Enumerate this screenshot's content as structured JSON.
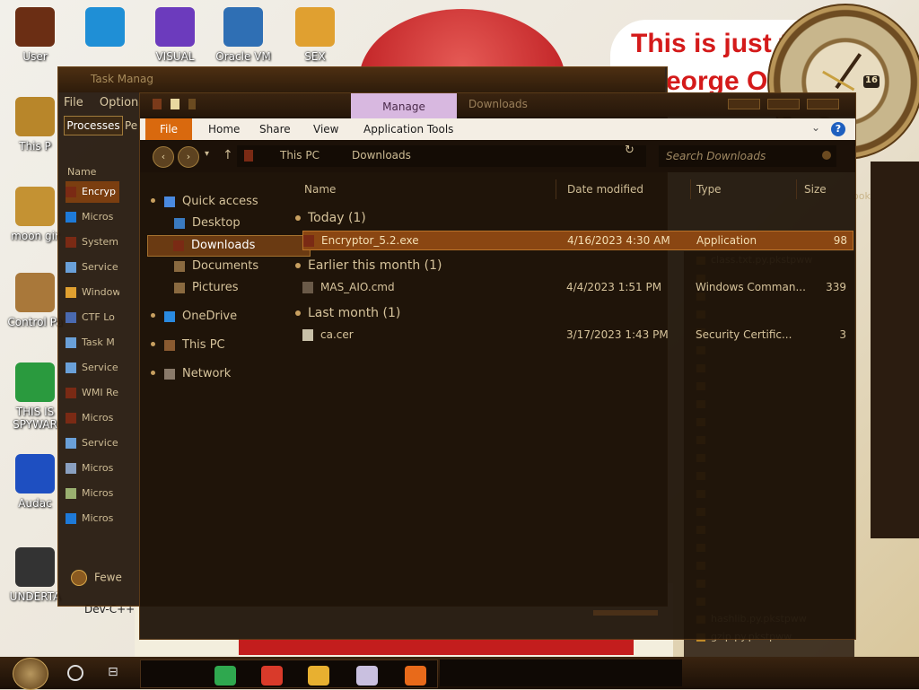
{
  "desktop": {
    "notice_line1": "This is just th",
    "notice_line2": "eorge Or",
    "clock_number": "16",
    "icons": [
      {
        "label": "User",
        "color": "#6b2e14"
      },
      {
        "label": "This P",
        "color": "#b8862a"
      },
      {
        "label": "moon gir",
        "color": "#c49233"
      },
      {
        "label": "Control Pa",
        "color": "#a9783a"
      },
      {
        "label": "THIS IS SPYWAR",
        "color": "#2a9a3e"
      },
      {
        "label": "Audac",
        "color": "#1e4fc1"
      },
      {
        "label": "UNDERTA",
        "color": "#333333"
      }
    ],
    "top_icons": [
      {
        "label": "",
        "color": "#1f8fd6"
      },
      {
        "label": "VISUAL",
        "color": "#6c3bbd"
      },
      {
        "label": "Oracle VM",
        "color": "#2f6fb4"
      },
      {
        "label": "SEX",
        "color": "#e0a030"
      }
    ],
    "bookmark": "ookmark   To",
    "right_list": [
      "class.txt.py.pkstpww",
      "",
      "",
      "",
      "",
      "",
      "",
      "",
      "",
      "",
      "",
      "",
      "",
      "",
      "",
      "",
      "",
      "",
      "",
      "",
      "hashlib.py.pkstpww",
      "gzip.py.pkstpww"
    ],
    "devcpp": "Dev-C++"
  },
  "task_manager": {
    "title": "Task Manag",
    "menu": [
      "File",
      "Options"
    ],
    "tab_processes": "Processes",
    "tab_pe": "Pe",
    "column_name": "Name",
    "rows": [
      {
        "label": "Encryp",
        "color": "#7a2a14",
        "selected": true
      },
      {
        "label": "Micros",
        "color": "#1e7ad8",
        "selected": false
      },
      {
        "label": "System",
        "color": "#7a2a14",
        "selected": false
      },
      {
        "label": "Service",
        "color": "#6aa0d8",
        "selected": false
      },
      {
        "label": "Window",
        "color": "#e0a030",
        "selected": false
      },
      {
        "label": "CTF Lo",
        "color": "#4a6ab0",
        "selected": false
      },
      {
        "label": "Task M",
        "color": "#6aa0d8",
        "selected": false
      },
      {
        "label": "Service",
        "color": "#6aa0d8",
        "selected": false
      },
      {
        "label": "WMI Re",
        "color": "#7a2a14",
        "selected": false
      },
      {
        "label": "Micros",
        "color": "#7a2a14",
        "selected": false
      },
      {
        "label": "Service",
        "color": "#6aa0d8",
        "selected": false
      },
      {
        "label": "Micros",
        "color": "#8aa0c0",
        "selected": false
      },
      {
        "label": "Micros",
        "color": "#9ab070",
        "selected": false
      },
      {
        "label": "Micros",
        "color": "#1e7ad8",
        "selected": false
      }
    ],
    "fewer_details": "Fewe"
  },
  "explorer": {
    "manage_tab": "Manage",
    "title": "Downloads",
    "ribbon": {
      "file": "File",
      "home": "Home",
      "share": "Share",
      "view": "View",
      "app_tools": "Application Tools",
      "help": "?"
    },
    "address": {
      "back": "‹",
      "forward": "›",
      "up": "↑",
      "crumb1": "This PC",
      "crumb2": "Downloads",
      "refresh": "↻",
      "search_placeholder": "Search Downloads"
    },
    "nav": [
      {
        "label": "Quick access",
        "icon": "star-icon",
        "color": "#4a8ae0",
        "selected": false,
        "indent": 0
      },
      {
        "label": "Desktop",
        "icon": "desktop-folder-icon",
        "color": "#3a7ac0",
        "selected": false,
        "indent": 1
      },
      {
        "label": "Downloads",
        "icon": "downloads-folder-icon",
        "color": "#7a2a14",
        "selected": true,
        "indent": 1
      },
      {
        "label": "Documents",
        "icon": "documents-folder-icon",
        "color": "#8a6a40",
        "selected": false,
        "indent": 1
      },
      {
        "label": "Pictures",
        "icon": "pictures-folder-icon",
        "color": "#8a6a40",
        "selected": false,
        "indent": 1
      },
      {
        "label": "OneDrive",
        "icon": "cloud-icon",
        "color": "#2a8ae0",
        "selected": false,
        "indent": 0
      },
      {
        "label": "This PC",
        "icon": "computer-icon",
        "color": "#8a5a30",
        "selected": false,
        "indent": 0
      },
      {
        "label": "Network",
        "icon": "network-icon",
        "color": "#8a7a6a",
        "selected": false,
        "indent": 0
      }
    ],
    "columns": {
      "name": "Name",
      "date": "Date modified",
      "type": "Type",
      "size": "Size"
    },
    "groups": [
      {
        "label": "Today (1)",
        "files": [
          {
            "name": "Encryptor_5.2.exe",
            "date": "4/16/2023 4:30 AM",
            "type": "Application",
            "size": "98",
            "selected": true,
            "color": "#7a2a14"
          }
        ]
      },
      {
        "label": "Earlier this month (1)",
        "files": [
          {
            "name": "MAS_AIO.cmd",
            "date": "4/4/2023 1:51 PM",
            "type": "Windows Comman...",
            "size": "339",
            "selected": false,
            "color": "#6a5a48"
          }
        ]
      },
      {
        "label": "Last month (1)",
        "files": [
          {
            "name": "ca.cer",
            "date": "3/17/2023 1:43 PM",
            "type": "Security Certific...",
            "size": "3",
            "selected": false,
            "color": "#c8c0a8"
          }
        ]
      }
    ]
  },
  "taskbar": {
    "apps": [
      {
        "name": "notes-app-icon",
        "color": "#2fa84f"
      },
      {
        "name": "chrome-icon",
        "color": "#d93a2a"
      },
      {
        "name": "file-explorer-icon",
        "color": "#e8b030"
      },
      {
        "name": "paint-icon",
        "color": "#c9c0e0"
      },
      {
        "name": "search-magnifier-icon",
        "color": "#e86a1a"
      }
    ]
  }
}
